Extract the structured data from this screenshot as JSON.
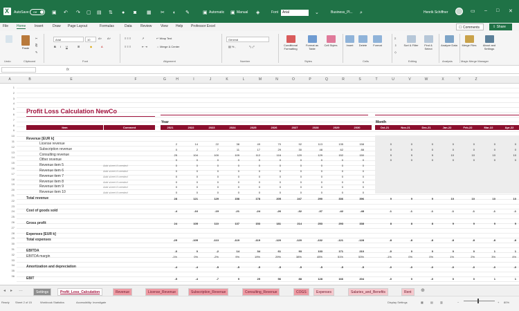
{
  "titlebar": {
    "autosave": "AutoSave",
    "autosave_state": "Off",
    "automatic": "Automatic",
    "manual": "Manual",
    "font_label": "Font",
    "font_value": "Arial",
    "filename": "Business_Pl...",
    "user": "Henrik Schiffner"
  },
  "menu": [
    "File",
    "Home",
    "Insert",
    "Draw",
    "Page Layout",
    "Formulas",
    "Data",
    "Review",
    "View",
    "Help",
    "Professor Excel"
  ],
  "menu_active": "Home",
  "comments": "Comments",
  "share": "Share",
  "ribbon": {
    "paste": "Paste",
    "font_name": "Arial",
    "font_size": "10",
    "wrap_text": "Wrap Text",
    "merge_center": "Merge & Center",
    "number_format": "General",
    "conditional_formatting": "Conditional Formatting",
    "format_as_table": "Format as Table",
    "cell_styles": "Cell Styles",
    "insert": "Insert",
    "delete": "Delete",
    "format": "Format",
    "sort_filter": "Sort & Filter",
    "find_select": "Find & Select",
    "analyze_data": "Analyze Data",
    "merge_files": "Merge Files",
    "about_settings": "About and Settings",
    "groups": [
      "Undo",
      "Clipboard",
      "Font",
      "Alignment",
      "Number",
      "Styles",
      "Cells",
      "Editing",
      "Analysis",
      "Magic Merge Manager"
    ]
  },
  "formula_bar": {
    "fx": "fx"
  },
  "columns": [
    "A",
    "B",
    "E",
    "F",
    "G",
    "H",
    "I",
    "J",
    "K",
    "L",
    "M",
    "N",
    "O",
    "P",
    "Q",
    "R",
    "S",
    "T",
    "U",
    "V",
    "W",
    "X",
    "Y",
    "Z"
  ],
  "rows": [
    "1",
    "2",
    "3",
    "4",
    "5",
    "6",
    "7",
    "8",
    "9",
    "10",
    "11",
    "12",
    "13",
    "14",
    "15",
    "16",
    "17",
    "18",
    "19",
    "20",
    "21",
    "22",
    "23",
    "24",
    "25",
    "26",
    "27",
    "28",
    "29",
    "30",
    "31",
    "32",
    "33",
    "34",
    "35",
    "36"
  ],
  "sheet": {
    "title": "Profit Loss Calculation NewCo",
    "year_label": "Year",
    "month_label": "Month",
    "item_header": "Item",
    "comment_header": "Comment",
    "years": [
      "2021",
      "2022",
      "2023",
      "2024",
      "2025",
      "2026",
      "2027",
      "2028",
      "2029",
      "2030"
    ],
    "months": [
      "Oct-21",
      "Nov-21",
      "Dec-21",
      "Jan-22",
      "Feb-22",
      "Mar-22",
      "Apr-22"
    ],
    "revenue_header": "Revenue [EUR k]",
    "revenue_items": [
      {
        "label": "License revenue",
        "comment": "",
        "values": [
          "2",
          "14",
          "22",
          "38",
          "49",
          "70",
          "92",
          "113",
          "135",
          "158"
        ],
        "months": [
          "0",
          "0",
          "0",
          "0",
          "0",
          "0",
          "0"
        ]
      },
      {
        "label": "Subscription revenue",
        "comment": "",
        "values": [
          "0",
          "2",
          "7",
          "11",
          "17",
          "29",
          "30",
          "48",
          "62",
          "88"
        ],
        "months": [
          "0",
          "0",
          "0",
          "0",
          "0",
          "0",
          "0"
        ]
      },
      {
        "label": "Consulting revenue",
        "comment": "",
        "values": [
          "25",
          "104",
          "100",
          "109",
          "112",
          "116",
          "120",
          "129",
          "152",
          "150"
        ],
        "months": [
          "9",
          "9",
          "9",
          "10",
          "10",
          "10",
          "10"
        ]
      },
      {
        "label": "Other revenue",
        "comment": "",
        "values": [
          "0",
          "0",
          "0",
          "0",
          "0",
          "0",
          "0",
          "0",
          "0",
          "0"
        ],
        "months": [
          "0",
          "0",
          "0",
          "0",
          "0",
          "0",
          "0"
        ]
      },
      {
        "label": "Revenue item 5",
        "comment": "Add sheet if needed",
        "values": [
          "0",
          "0",
          "0",
          "0",
          "0",
          "0",
          "0",
          "0",
          "0",
          "0"
        ],
        "months": [
          "",
          "",
          "",
          "",
          "",
          "",
          ""
        ]
      },
      {
        "label": "Revenue item 6",
        "comment": "Add sheet if needed",
        "values": [
          "0",
          "0",
          "0",
          "0",
          "0",
          "0",
          "0",
          "0",
          "0",
          "0"
        ],
        "months": [
          "",
          "",
          "",
          "",
          "",
          "",
          ""
        ]
      },
      {
        "label": "Revenue item 7",
        "comment": "Add sheet if needed",
        "values": [
          "0",
          "0",
          "0",
          "0",
          "0",
          "0",
          "0",
          "0",
          "0",
          "0"
        ],
        "months": [
          "",
          "",
          "",
          "",
          "",
          "",
          ""
        ]
      },
      {
        "label": "Revenue item 8",
        "comment": "Add sheet if needed",
        "values": [
          "0",
          "0",
          "0",
          "0",
          "0",
          "0",
          "0",
          "0",
          "0",
          "0"
        ],
        "months": [
          "",
          "",
          "",
          "",
          "",
          "",
          ""
        ]
      },
      {
        "label": "Revenue item 9",
        "comment": "Add sheet if needed",
        "values": [
          "0",
          "0",
          "0",
          "0",
          "0",
          "0",
          "0",
          "0",
          "0",
          "0"
        ],
        "months": [
          "",
          "",
          "",
          "",
          "",
          "",
          ""
        ]
      },
      {
        "label": "Revenue item 10",
        "comment": "Add sheet if needed",
        "values": [
          "0",
          "0",
          "0",
          "0",
          "0",
          "0",
          "0",
          "0",
          "0",
          "0"
        ],
        "months": [
          "",
          "",
          "",
          "",
          "",
          "",
          ""
        ]
      }
    ],
    "summary_rows": [
      {
        "label": "Total revenue",
        "bold": true,
        "values": [
          "28",
          "121",
          "129",
          "158",
          "178",
          "205",
          "247",
          "290",
          "336",
          "396"
        ],
        "months": [
          "9",
          "9",
          "9",
          "10",
          "10",
          "10",
          "10"
        ]
      },
      {
        "label": "Cost of goods sold",
        "bold": true,
        "values": [
          "-4",
          "-16",
          "-19",
          "-21",
          "-24",
          "-26",
          "-32",
          "-37",
          "-42",
          "-48"
        ],
        "months": [
          "-1",
          "-1",
          "-1",
          "-1",
          "-1",
          "-1",
          "-1"
        ]
      },
      {
        "label": "Gross profit",
        "bold": true,
        "values": [
          "24",
          "105",
          "110",
          "137",
          "153",
          "181",
          "214",
          "253",
          "293",
          "338"
        ],
        "months": [
          "8",
          "8",
          "8",
          "9",
          "9",
          "9",
          "9"
        ]
      },
      {
        "label": "Expenses [EUR k]",
        "bold": true,
        "values": [],
        "months": []
      },
      {
        "label": "Total expenses",
        "bold": true,
        "values": [
          "-25",
          "-105",
          "-113",
          "-119",
          "-119",
          "-120",
          "-120",
          "-132",
          "-121",
          "-128"
        ],
        "months": [
          "-8",
          "-8",
          "-8",
          "-8",
          "-8",
          "-8",
          "-8"
        ]
      },
      {
        "label": "EBITDA",
        "bold": true,
        "values": [
          "-0",
          "0",
          "-2",
          "14",
          "34",
          "61",
          "93",
          "133",
          "171",
          "210"
        ],
        "months": [
          "-0",
          "0",
          "0",
          "0",
          "0",
          "1",
          "1"
        ]
      },
      {
        "label": "EBITDA margin",
        "bold": false,
        "values": [
          "-1%",
          "0%",
          "-2%",
          "9%",
          "19%",
          "29%",
          "38%",
          "45%",
          "51%",
          "53%"
        ],
        "months": [
          "-1%",
          "0%",
          "0%",
          "1%",
          "2%",
          "3%",
          "4%"
        ]
      },
      {
        "label": "Amortization and depreciation",
        "bold": true,
        "values": [
          "-4",
          "-4",
          "-5",
          "-5",
          "-5",
          "-5",
          "-5",
          "-5",
          "-5",
          "-5"
        ],
        "months": [
          "-0",
          "-0",
          "-0",
          "-0",
          "-0",
          "-0",
          "-0"
        ]
      },
      {
        "label": "EBIT",
        "bold": true,
        "values": [
          "-5",
          "-4",
          "-7",
          "9",
          "29",
          "56",
          "88",
          "128",
          "166",
          "204"
        ],
        "months": [
          "-0",
          "0",
          "-0",
          "0",
          "0",
          "1",
          "1"
        ]
      }
    ]
  },
  "tabs": [
    "Settings",
    "Profit_Loss_Calculation",
    "Revenue",
    "License_Revenue",
    "Subscription_Revenue",
    "Consulting_Revenue",
    "COGS",
    "Expenses",
    "Salaries_and_Benefits",
    "Rent"
  ],
  "status": {
    "ready": "Ready",
    "sheet_count": "Sheet 2 of 15",
    "workbook_stats": "Workbook Statistics",
    "accessibility": "Accessibility: Investigate",
    "display_settings": "Display Settings",
    "zoom": "80%"
  }
}
